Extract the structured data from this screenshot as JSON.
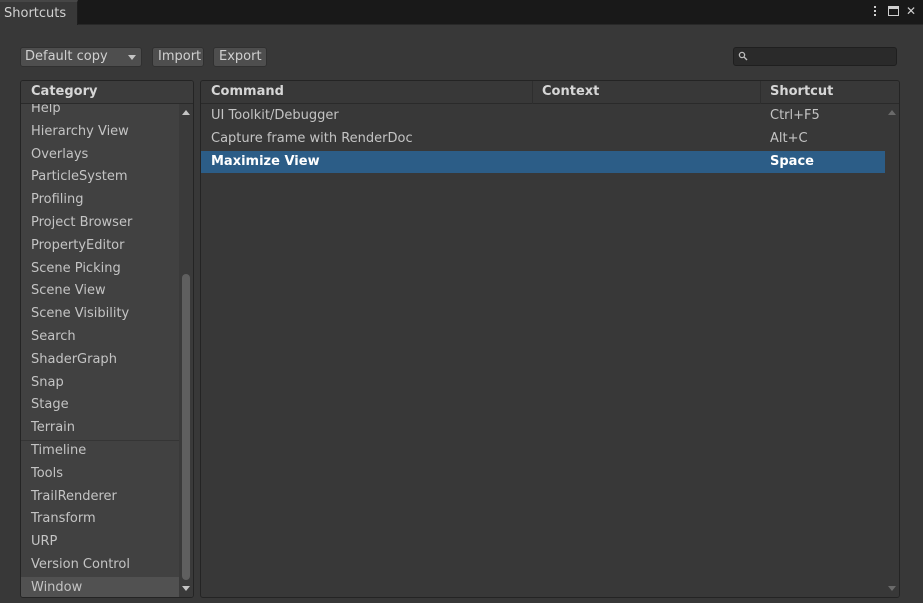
{
  "window": {
    "tab_title": "Shortcuts",
    "buttons": [
      "more-options-icon",
      "maximize-icon",
      "close-icon"
    ],
    "close_glyph": "✕"
  },
  "toolbar": {
    "profile_dropdown": "Default copy",
    "import_label": "Import",
    "export_label": "Export",
    "search_value": ""
  },
  "category": {
    "header": "Category",
    "items": [
      {
        "label": "Help"
      },
      {
        "label": "Hierarchy View"
      },
      {
        "label": "Overlays"
      },
      {
        "label": "ParticleSystem"
      },
      {
        "label": "Profiling"
      },
      {
        "label": "Project Browser"
      },
      {
        "label": "PropertyEditor"
      },
      {
        "label": "Scene Picking"
      },
      {
        "label": "Scene View"
      },
      {
        "label": "Scene Visibility"
      },
      {
        "label": "Search"
      },
      {
        "label": "ShaderGraph"
      },
      {
        "label": "Snap"
      },
      {
        "label": "Stage"
      },
      {
        "label": "Terrain"
      },
      {
        "label": "Timeline"
      },
      {
        "label": "Tools"
      },
      {
        "label": "TrailRenderer"
      },
      {
        "label": "Transform"
      },
      {
        "label": "URP"
      },
      {
        "label": "Version Control"
      },
      {
        "label": "Window"
      }
    ],
    "selected": "Window"
  },
  "table": {
    "headers": {
      "command": "Command",
      "context": "Context",
      "shortcut": "Shortcut"
    },
    "rows": [
      {
        "command": "UI Toolkit/Debugger",
        "context": "",
        "shortcut": "Ctrl+F5"
      },
      {
        "command": "Capture frame with RenderDoc",
        "context": "",
        "shortcut": "Alt+C"
      },
      {
        "command": "Maximize View",
        "context": "",
        "shortcut": "Space"
      }
    ],
    "selected_row": "Maximize View"
  },
  "colors": {
    "selection_blue": "#2c5d87",
    "panel_bg": "#383838",
    "titlebar_bg": "#191919"
  }
}
